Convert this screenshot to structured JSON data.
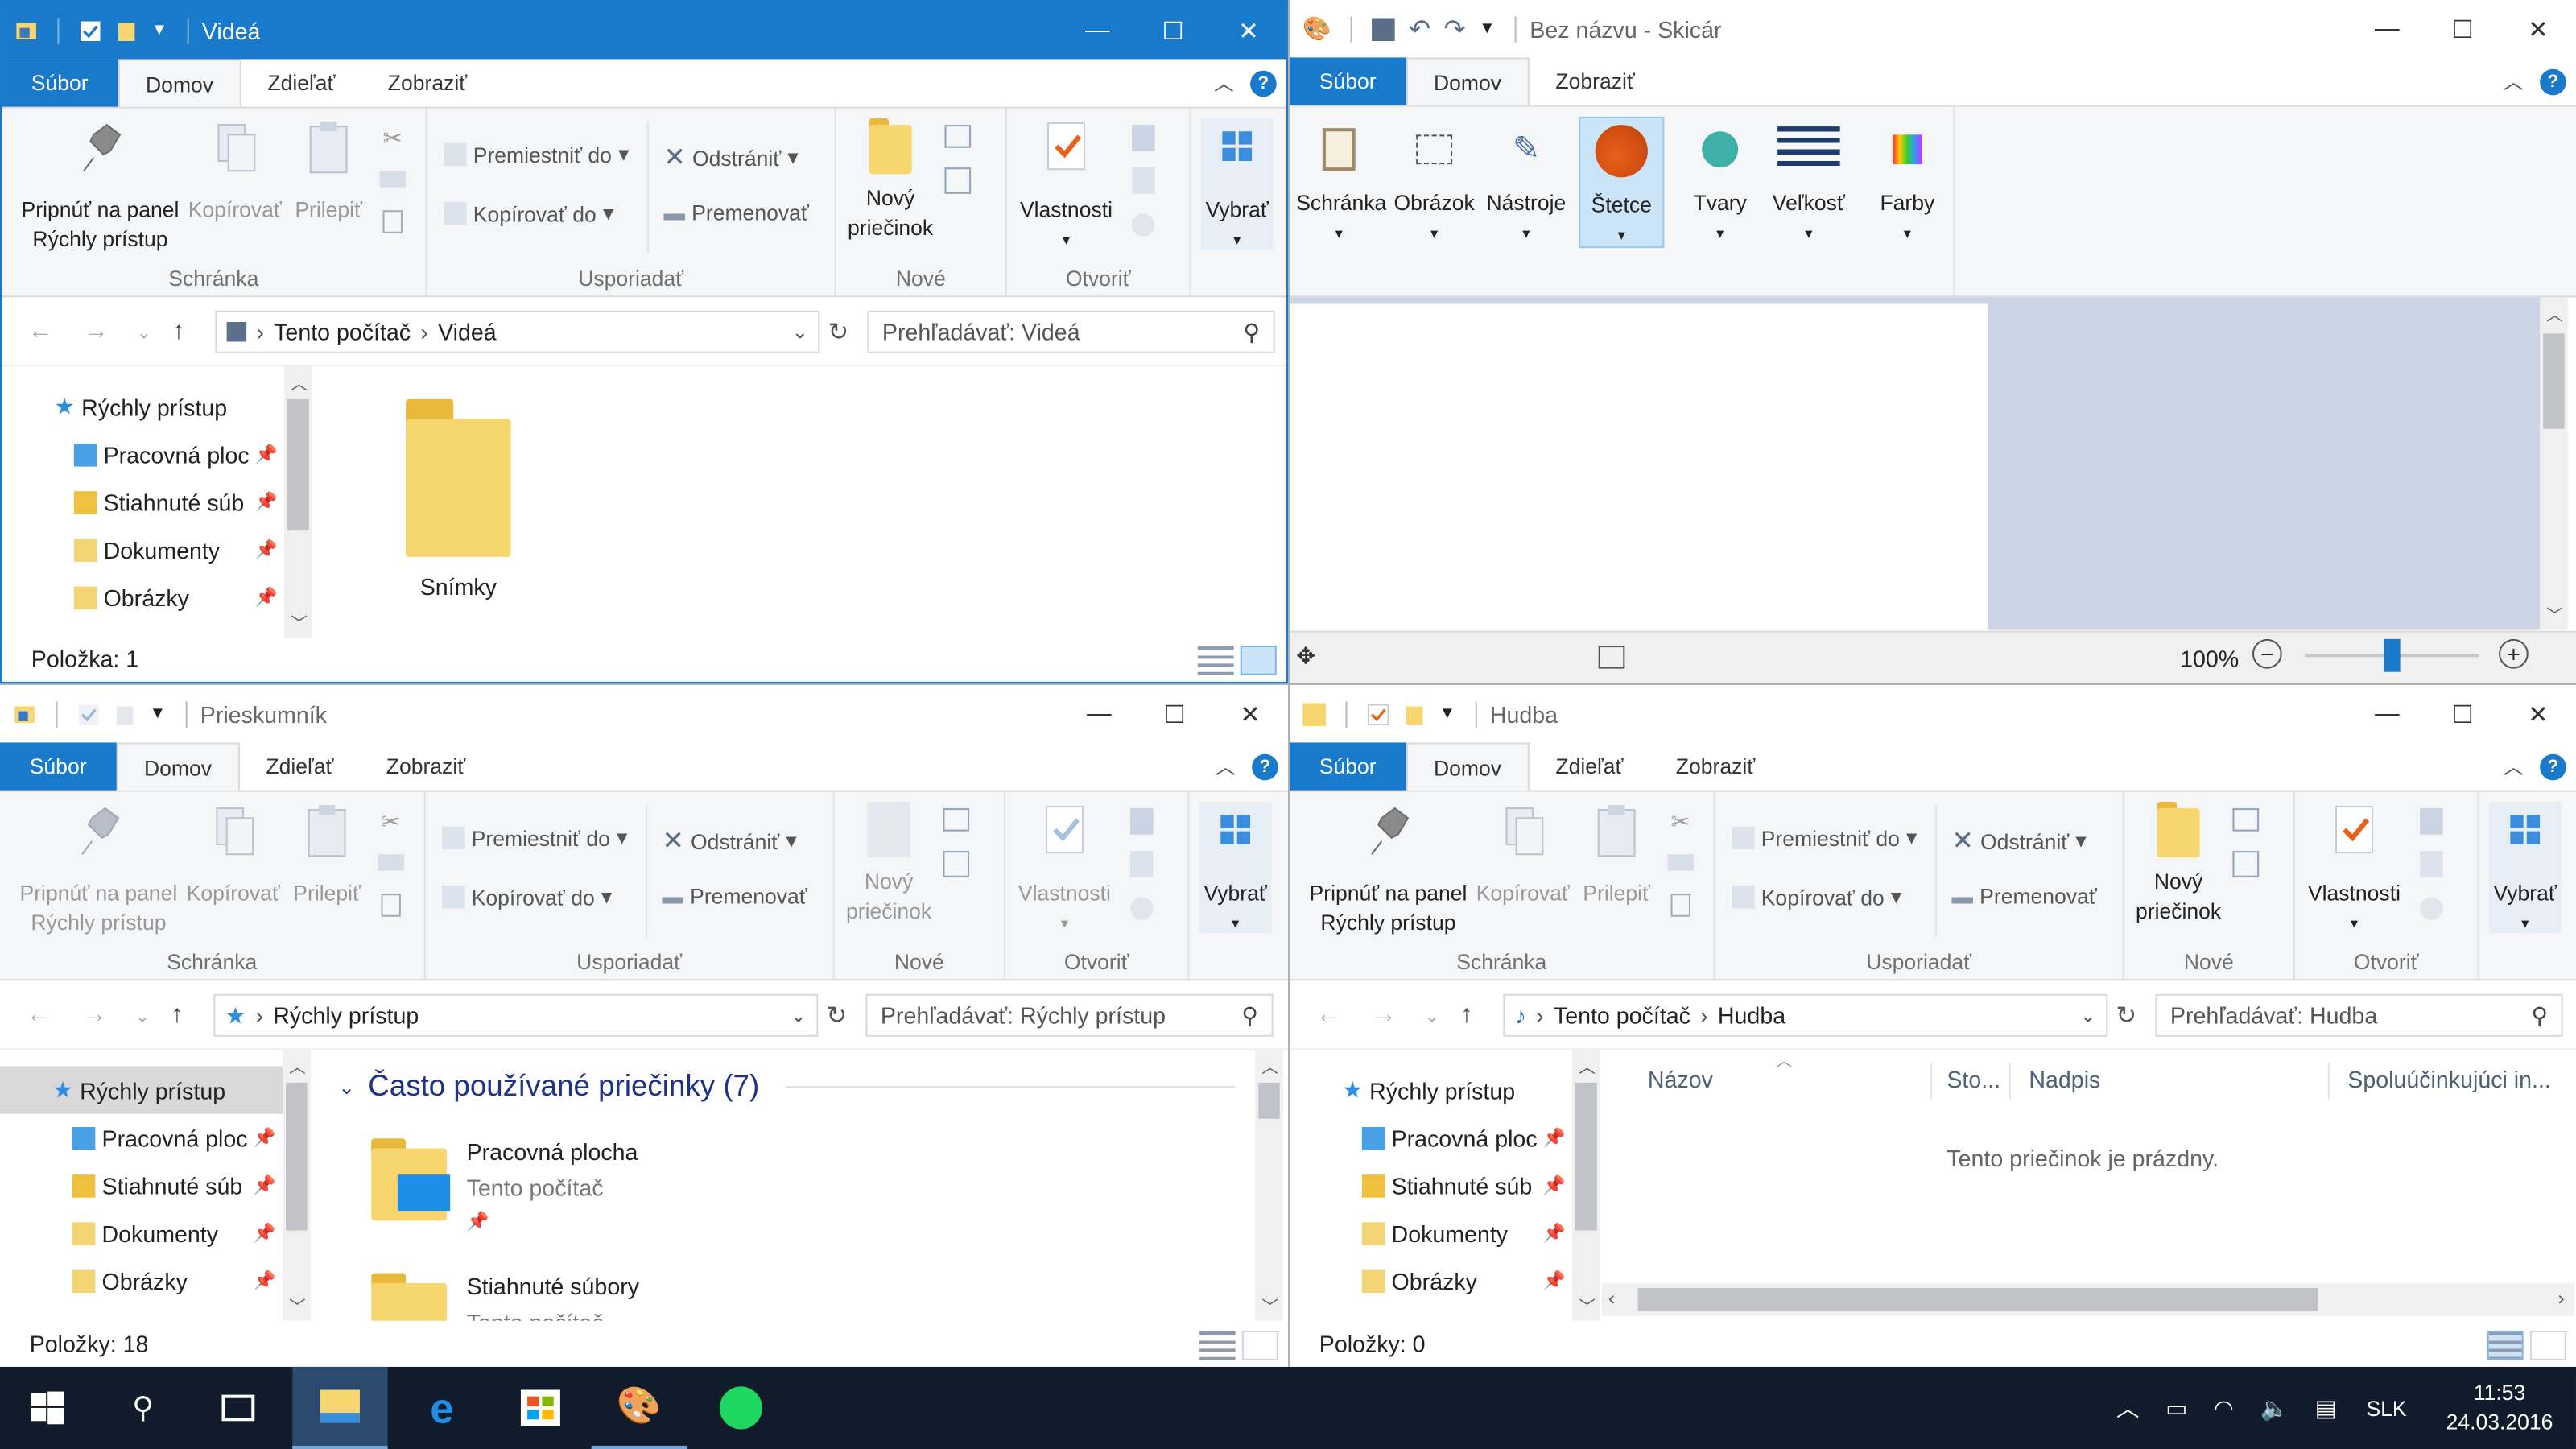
{
  "win1": {
    "title": "Videá",
    "tabs": {
      "file": "Súbor",
      "home": "Domov",
      "share": "Zdieľať",
      "view": "Zobraziť"
    },
    "ribbon": {
      "pin": [
        "Pripnúť na panel",
        "Rýchly prístup"
      ],
      "copy": "Kopírovať",
      "paste": "Prilepiť",
      "clipboard_group": "Schránka",
      "move_to": "Premiestniť do",
      "copy_to": "Kopírovať do",
      "delete": "Odstrániť",
      "rename": "Premenovať",
      "organize_group": "Usporiadať",
      "new_folder": [
        "Nový",
        "priečinok"
      ],
      "new_group": "Nové",
      "properties": "Vlastnosti",
      "open_group": "Otvoriť",
      "select": "Vybrať"
    },
    "path": [
      "Tento počítač",
      "Videá"
    ],
    "search_placeholder": "Prehľadávať: Videá",
    "nav": [
      "Rýchly prístup",
      "Pracovná ploc",
      "Stiahnuté súb",
      "Dokumenty",
      "Obrázky"
    ],
    "items": [
      "Snímky"
    ],
    "status": "Položka: 1"
  },
  "win2": {
    "title": "Bez názvu - Skicár",
    "tabs": {
      "file": "Súbor",
      "home": "Domov",
      "view": "Zobraziť"
    },
    "tools": [
      "Schránka",
      "Obrázok",
      "Nástroje",
      "Štetce",
      "Tvary",
      "Veľkosť",
      "Farby"
    ],
    "zoom": "100%"
  },
  "win3": {
    "title": "Prieskumník",
    "tabs": {
      "file": "Súbor",
      "home": "Domov",
      "share": "Zdieľať",
      "view": "Zobraziť"
    },
    "ribbon": {
      "pin": [
        "Pripnúť na panel",
        "Rýchly prístup"
      ],
      "copy": "Kopírovať",
      "paste": "Prilepiť",
      "clipboard_group": "Schránka",
      "move_to": "Premiestniť do",
      "copy_to": "Kopírovať do",
      "delete": "Odstrániť",
      "rename": "Premenovať",
      "organize_group": "Usporiadať",
      "new_folder": [
        "Nový",
        "priečinok"
      ],
      "new_group": "Nové",
      "properties": "Vlastnosti",
      "open_group": "Otvoriť",
      "select": "Vybrať"
    },
    "path": [
      "Rýchly prístup"
    ],
    "search_placeholder": "Prehľadávať: Rýchly prístup",
    "nav": [
      "Rýchly prístup",
      "Pracovná ploc",
      "Stiahnuté súb",
      "Dokumenty",
      "Obrázky"
    ],
    "section": "Často používané priečinky (7)",
    "items": [
      {
        "name": "Pracovná plocha",
        "loc": "Tento počítač"
      },
      {
        "name": "Stiahnuté súbory",
        "loc": "Tento počítač"
      }
    ],
    "status": "Položky: 18"
  },
  "win4": {
    "title": "Hudba",
    "tabs": {
      "file": "Súbor",
      "home": "Domov",
      "share": "Zdieľať",
      "view": "Zobraziť"
    },
    "ribbon": {
      "pin": [
        "Pripnúť na panel",
        "Rýchly prístup"
      ],
      "copy": "Kopírovať",
      "paste": "Prilepiť",
      "clipboard_group": "Schránka",
      "move_to": "Premiestniť do",
      "copy_to": "Kopírovať do",
      "delete": "Odstrániť",
      "rename": "Premenovať",
      "organize_group": "Usporiadať",
      "new_folder": [
        "Nový",
        "priečinok"
      ],
      "new_group": "Nové",
      "properties": "Vlastnosti",
      "open_group": "Otvoriť",
      "select": "Vybrať"
    },
    "path": [
      "Tento počítač",
      "Hudba"
    ],
    "search_placeholder": "Prehľadávať: Hudba",
    "nav": [
      "Rýchly prístup",
      "Pracovná ploc",
      "Stiahnuté súb",
      "Dokumenty",
      "Obrázky"
    ],
    "columns": [
      "Názov",
      "Sto...",
      "Nadpis",
      "Spoluúčinkujúci in..."
    ],
    "empty": "Tento priečinok je prázdny.",
    "status": "Položky: 0"
  },
  "taskbar": {
    "lang": "SLK",
    "time": "11:53",
    "date": "24.03.2016"
  },
  "colors": {
    "accent": "#1979ca",
    "taskbar": "#101b2b",
    "folder": "#f7d670"
  }
}
